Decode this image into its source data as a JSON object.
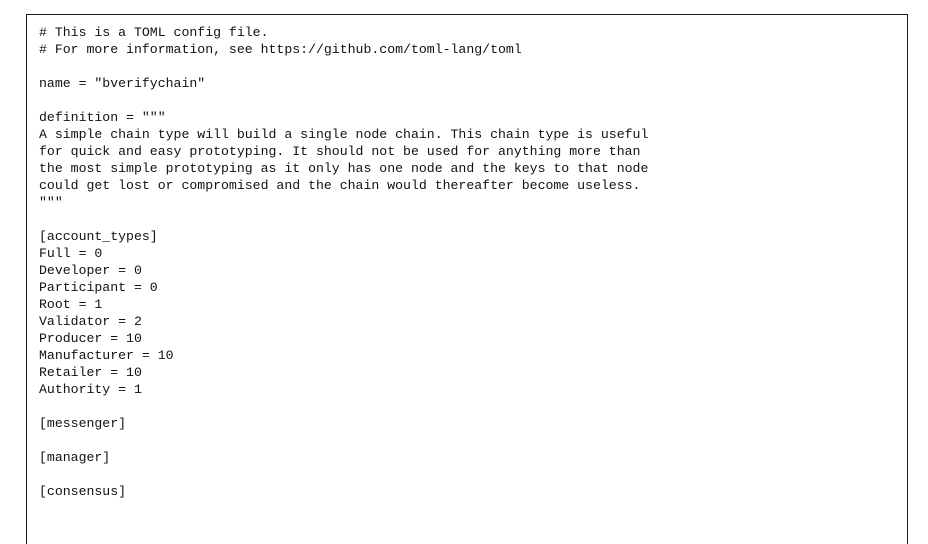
{
  "document": {
    "lines": [
      "# This is a TOML config file.",
      "# For more information, see https://github.com/toml-lang/toml",
      "",
      "name = \"bverifychain\"",
      "",
      "definition = \"\"\"",
      "A simple chain type will build a single node chain. This chain type is useful",
      "for quick and easy prototyping. It should not be used for anything more than",
      "the most simple prototyping as it only has one node and the keys to that node",
      "could get lost or compromised and the chain would thereafter become useless.",
      "\"\"\"",
      "",
      "[account_types]",
      "Full = 0",
      "Developer = 0",
      "Participant = 0",
      "Root = 1",
      "Validator = 2",
      "Producer = 10",
      "Manufacturer = 10",
      "Retailer = 10",
      "Authority = 1",
      "",
      "[messenger]",
      "",
      "[manager]",
      "",
      "[consensus]"
    ]
  }
}
